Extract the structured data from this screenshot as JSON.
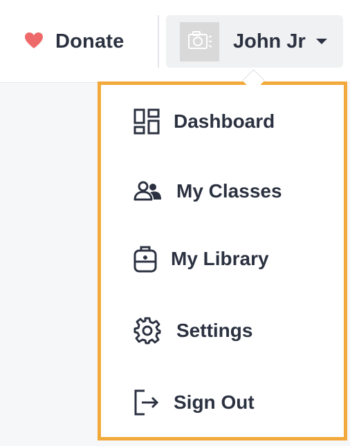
{
  "header": {
    "donate_label": "Donate",
    "donate_icon": "heart-icon",
    "user_name": "John Jr",
    "avatar_icon": "camera-icon",
    "caret_icon": "caret-down-icon"
  },
  "menu": {
    "border_color": "#f2a93b",
    "items": [
      {
        "label": "Dashboard",
        "icon": "dashboard-icon"
      },
      {
        "label": "My Classes",
        "icon": "classes-icon"
      },
      {
        "label": "My Library",
        "icon": "backpack-icon"
      },
      {
        "label": "Settings",
        "icon": "gear-icon"
      },
      {
        "label": "Sign Out",
        "icon": "sign-out-icon"
      }
    ]
  },
  "colors": {
    "heart": "#ee6a6a",
    "text": "#2b3140",
    "accent_border": "#f2a93b"
  }
}
